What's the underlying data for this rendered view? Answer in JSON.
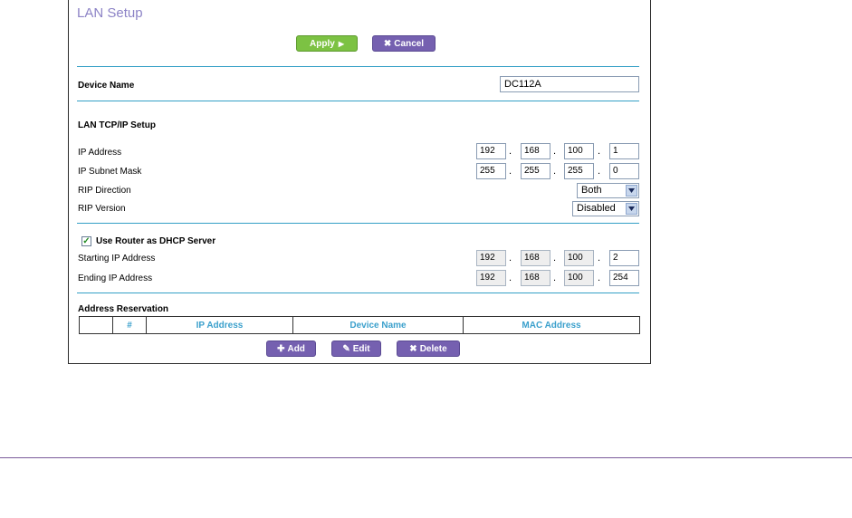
{
  "page": {
    "title": "LAN Setup"
  },
  "actions": {
    "apply_label": "Apply",
    "cancel_label": "Cancel"
  },
  "device": {
    "label": "Device Name",
    "value": "DC112A"
  },
  "tcpip": {
    "heading": "LAN TCP/IP Setup",
    "ip_label": "IP Address",
    "ip": [
      "192",
      "168",
      "100",
      "1"
    ],
    "mask_label": "IP Subnet Mask",
    "mask": [
      "255",
      "255",
      "255",
      "0"
    ],
    "rip_direction_label": "RIP Direction",
    "rip_direction_value": "Both",
    "rip_version_label": "RIP Version",
    "rip_version_value": "Disabled"
  },
  "dhcp": {
    "checkbox_label": "Use Router as DHCP Server",
    "checked": true,
    "start_label": "Starting IP Address",
    "start": [
      "192",
      "168",
      "100",
      "2"
    ],
    "end_label": "Ending IP Address",
    "end": [
      "192",
      "168",
      "100",
      "254"
    ]
  },
  "reservation": {
    "heading": "Address Reservation",
    "columns": [
      "",
      "#",
      "IP Address",
      "Device Name",
      "MAC Address"
    ],
    "add_label": "Add",
    "edit_label": "Edit",
    "delete_label": "Delete"
  },
  "colors": {
    "accent": "#34a0c6",
    "apply": "#7cc243",
    "button": "#7560b0",
    "title": "#8c83c6"
  }
}
